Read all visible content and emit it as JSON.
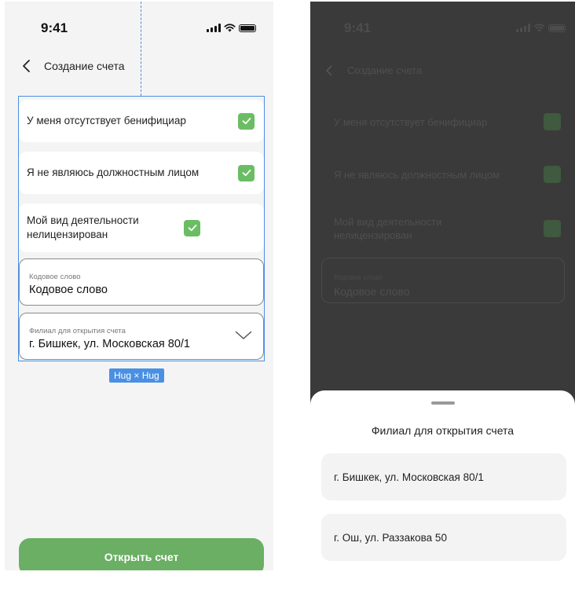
{
  "left": {
    "status": {
      "time": "9:41"
    },
    "nav": {
      "title": "Создание счета"
    },
    "checks": [
      {
        "label": "У меня отсутствует бенифициар",
        "checked": true
      },
      {
        "label": "Я не являюсь должностным лицом",
        "checked": true
      },
      {
        "label": "Мой вид деятельности нелицензирован",
        "checked": true
      }
    ],
    "codeword": {
      "label": "Кодовое слово",
      "value": "Кодовое слово"
    },
    "branch": {
      "label": "Филиал для открытия счета",
      "value": "г. Бишкек, ул. Московская 80/1"
    },
    "hug_badge": "Hug × Hug",
    "submit_label": "Открыть счет"
  },
  "right": {
    "status": {
      "time": "9:41"
    },
    "nav": {
      "title": "Создание счета"
    },
    "checks": [
      {
        "label": "У меня отсутствует бенифициар"
      },
      {
        "label": "Я не являюсь должностным лицом"
      },
      {
        "label": "Мой вид деятельности нелицензирован"
      }
    ],
    "codeword": {
      "label": "Кодовое слово",
      "value": "Кодовое слово"
    },
    "sheet": {
      "title": "Филиал для открытия счета",
      "options": [
        {
          "label": "г. Бишкек, ул. Московская 80/1"
        },
        {
          "label": "г. Ош, ул. Раззакова 50"
        }
      ]
    }
  },
  "colors": {
    "accent_green": "#6aaf63",
    "checkbox_green": "#6bbd63",
    "selection_blue": "#4a90e2",
    "overlay": "#3a3a3a"
  },
  "icons": [
    "back-chevron-icon",
    "checkmark-icon",
    "chevron-down-icon",
    "signal-icon",
    "wifi-icon",
    "battery-icon"
  ]
}
